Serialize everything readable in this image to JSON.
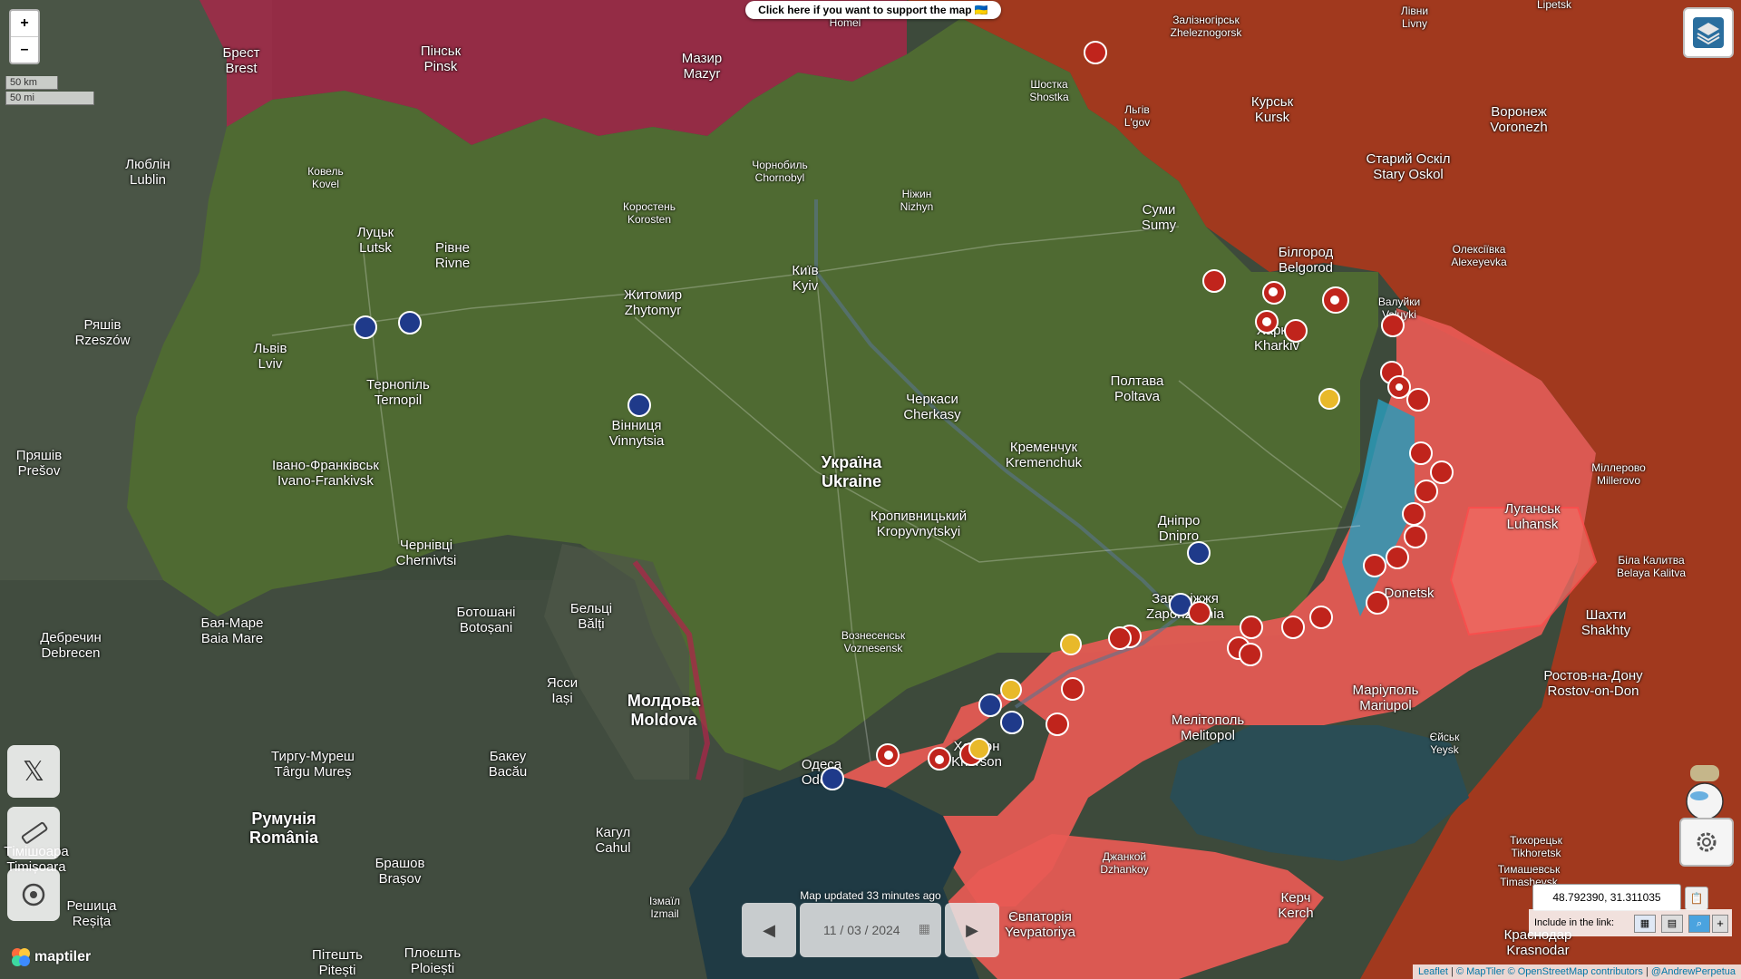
{
  "support_banner": "Click here if you want to support the map 🇺🇦",
  "zoom": {
    "in_label": "+",
    "out_label": "–"
  },
  "scale": {
    "km": "50 km",
    "mi": "50 mi"
  },
  "update_text": "Map updated 33 minutes ago",
  "date_value": "11 / 03 / 2024",
  "coordinates": "48.792390, 31.311035",
  "include_link_label": "Include in the link:",
  "attribution": {
    "leaflet": "Leaflet",
    "maptiler": "© MapTiler",
    "osm": "© OpenStreetMap contributors",
    "author": "@AndrewPerpetua"
  },
  "maptiler_logo": "maptiler",
  "colors": {
    "occupied": "#e85a55",
    "russia": "#b03a1e",
    "belarus": "#b2234a",
    "contested": "#2a9ab8",
    "ukraine": "#4f6a32"
  },
  "cities": [
    {
      "id": "homel",
      "line1": "Homel",
      "line2": ""
    },
    {
      "id": "brest",
      "line1": "Брест",
      "line2": "Brest"
    },
    {
      "id": "pinsk",
      "line1": "Пінськ",
      "line2": "Pinsk"
    },
    {
      "id": "mazyr",
      "line1": "Мазир",
      "line2": "Mazyr"
    },
    {
      "id": "zheleznogorsk",
      "line1": "Залізногірськ",
      "line2": "Zheleznogorsk"
    },
    {
      "id": "livny",
      "line1": "Лівни",
      "line2": "Livny"
    },
    {
      "id": "lipetsk",
      "line1": "Lipetsk",
      "line2": ""
    },
    {
      "id": "shostka",
      "line1": "Шостка",
      "line2": "Shostka"
    },
    {
      "id": "kovel",
      "line1": "Ковель",
      "line2": "Kovel"
    },
    {
      "id": "lublin",
      "line1": "Люблін",
      "line2": "Lublin"
    },
    {
      "id": "chornobyl",
      "line1": "Чорнобиль",
      "line2": "Chornobyl"
    },
    {
      "id": "lgov",
      "line1": "Льгів",
      "line2": "L'gov"
    },
    {
      "id": "kursk",
      "line1": "Курськ",
      "line2": "Kursk"
    },
    {
      "id": "voronezh",
      "line1": "Воронеж",
      "line2": "Voronezh"
    },
    {
      "id": "nizhyn",
      "line1": "Ніжин",
      "line2": "Nizhyn"
    },
    {
      "id": "korosten",
      "line1": "Коростень",
      "line2": "Korosten"
    },
    {
      "id": "staryoskol",
      "line1": "Старий Оскіл",
      "line2": "Stary Oskol"
    },
    {
      "id": "lutsk",
      "line1": "Луцьк",
      "line2": "Lutsk"
    },
    {
      "id": "rivne",
      "line1": "Рівне",
      "line2": "Rivne"
    },
    {
      "id": "sumy",
      "line1": "Суми",
      "line2": "Sumy"
    },
    {
      "id": "kyiv",
      "line1": "Київ",
      "line2": "Kyiv"
    },
    {
      "id": "belgorod",
      "line1": "Білгород",
      "line2": "Belgorod"
    },
    {
      "id": "alexeyevka",
      "line1": "Олексіївка",
      "line2": "Alexeyevka"
    },
    {
      "id": "zhytomyr",
      "line1": "Житомир",
      "line2": "Zhytomyr"
    },
    {
      "id": "valuyki",
      "line1": "Валуйки",
      "line2": "Valuyki"
    },
    {
      "id": "rzeszow",
      "line1": "Ряшів",
      "line2": "Rzeszów"
    },
    {
      "id": "kharkiv",
      "line1": "Харків",
      "line2": "Kharkiv"
    },
    {
      "id": "lviv",
      "line1": "Львів",
      "line2": "Lviv"
    },
    {
      "id": "ternopil",
      "line1": "Тернопіль",
      "line2": "Ternopil"
    },
    {
      "id": "poltava",
      "line1": "Полтава",
      "line2": "Poltava"
    },
    {
      "id": "cherkasy",
      "line1": "Черкаси",
      "line2": "Cherkasy"
    },
    {
      "id": "vinnytsia",
      "line1": "Вінниця",
      "line2": "Vinnytsia"
    },
    {
      "id": "presov",
      "line1": "Пряшів",
      "line2": "Prešov"
    },
    {
      "id": "kremenchuk",
      "line1": "Кременчук",
      "line2": "Kremenchuk"
    },
    {
      "id": "ukraine",
      "line1": "Україна",
      "line2": "Ukraine"
    },
    {
      "id": "ivanofrankivsk",
      "line1": "Івано-Франківськ",
      "line2": "Ivano-Frankivsk"
    },
    {
      "id": "millerovo",
      "line1": "Міллерово",
      "line2": "Millerovo"
    },
    {
      "id": "luhansk",
      "line1": "Луганськ",
      "line2": "Luhansk"
    },
    {
      "id": "kropyvnytskyi",
      "line1": "Кропивницький",
      "line2": "Kropyvnytskyi"
    },
    {
      "id": "dnipro",
      "line1": "Дніпро",
      "line2": "Dnipro"
    },
    {
      "id": "chernivtsi",
      "line1": "Чернівці",
      "line2": "Chernivtsi"
    },
    {
      "id": "belayakalitva",
      "line1": "Біла Калитва",
      "line2": "Belaya Kalitva"
    },
    {
      "id": "donetsk",
      "line1": "",
      "line2": "Donetsk"
    },
    {
      "id": "zaporizhzhia",
      "line1": "Запоріжжя",
      "line2": "Zaporizhzhia"
    },
    {
      "id": "balti",
      "line1": "Бельці",
      "line2": "Bălți"
    },
    {
      "id": "botosani",
      "line1": "Ботошані",
      "line2": "Botoșani"
    },
    {
      "id": "debrecen",
      "line1": "Дебречин",
      "line2": "Debrecen"
    },
    {
      "id": "baiamare",
      "line1": "Бая-Маре",
      "line2": "Baia Mare"
    },
    {
      "id": "shakhty",
      "line1": "Шахти",
      "line2": "Shakhty"
    },
    {
      "id": "voznesensk",
      "line1": "Вознесенськ",
      "line2": "Voznesensk"
    },
    {
      "id": "iasi",
      "line1": "Ясси",
      "line2": "Iași"
    },
    {
      "id": "moldova",
      "line1": "Молдова",
      "line2": "Moldova"
    },
    {
      "id": "rostov",
      "line1": "Ростов-на-Дону",
      "line2": "Rostov-on-Don"
    },
    {
      "id": "mariupol",
      "line1": "Маріуполь",
      "line2": "Mariupol"
    },
    {
      "id": "melitopol",
      "line1": "Мелітополь",
      "line2": "Melitopol"
    },
    {
      "id": "yeysk",
      "line1": "Єйськ",
      "line2": "Yeysk"
    },
    {
      "id": "kherson",
      "line1": "Херсон",
      "line2": "Kherson"
    },
    {
      "id": "targumures",
      "line1": "Тиргу-Муреш",
      "line2": "Târgu Mureș"
    },
    {
      "id": "bacau",
      "line1": "Бакеу",
      "line2": "Bacău"
    },
    {
      "id": "odesa",
      "line1": "Одеса",
      "line2": "Odesa"
    },
    {
      "id": "romania",
      "line1": "Румунія",
      "line2": "România"
    },
    {
      "id": "cahul",
      "line1": "Кагул",
      "line2": "Cahul"
    },
    {
      "id": "tikhoretsk",
      "line1": "Тихорецьк",
      "line2": "Tikhoretsk"
    },
    {
      "id": "timisoara",
      "line1": "Тімішоара",
      "line2": "Timișoara"
    },
    {
      "id": "dzhankoi",
      "line1": "Джанкой",
      "line2": "Dzhankoy"
    },
    {
      "id": "brasov",
      "line1": "Брашов",
      "line2": "Brașov"
    },
    {
      "id": "timashevsk",
      "line1": "Тимашевськ",
      "line2": "Timashevsk"
    },
    {
      "id": "izmail",
      "line1": "Ізмаїл",
      "line2": "Izmail"
    },
    {
      "id": "resita",
      "line1": "Решица",
      "line2": "Reșița"
    },
    {
      "id": "kerch",
      "line1": "Керч",
      "line2": "Kerch"
    },
    {
      "id": "yevpatoriya",
      "line1": "Євпаторія",
      "line2": "Yevpatoriya"
    },
    {
      "id": "pitesti",
      "line1": "Пітешть",
      "line2": "Pitești"
    },
    {
      "id": "ploiesti",
      "line1": "Плоєшть",
      "line2": "Ploiești"
    },
    {
      "id": "krasnodar",
      "line1": "Краснодар",
      "line2": "Krasnodar"
    }
  ]
}
